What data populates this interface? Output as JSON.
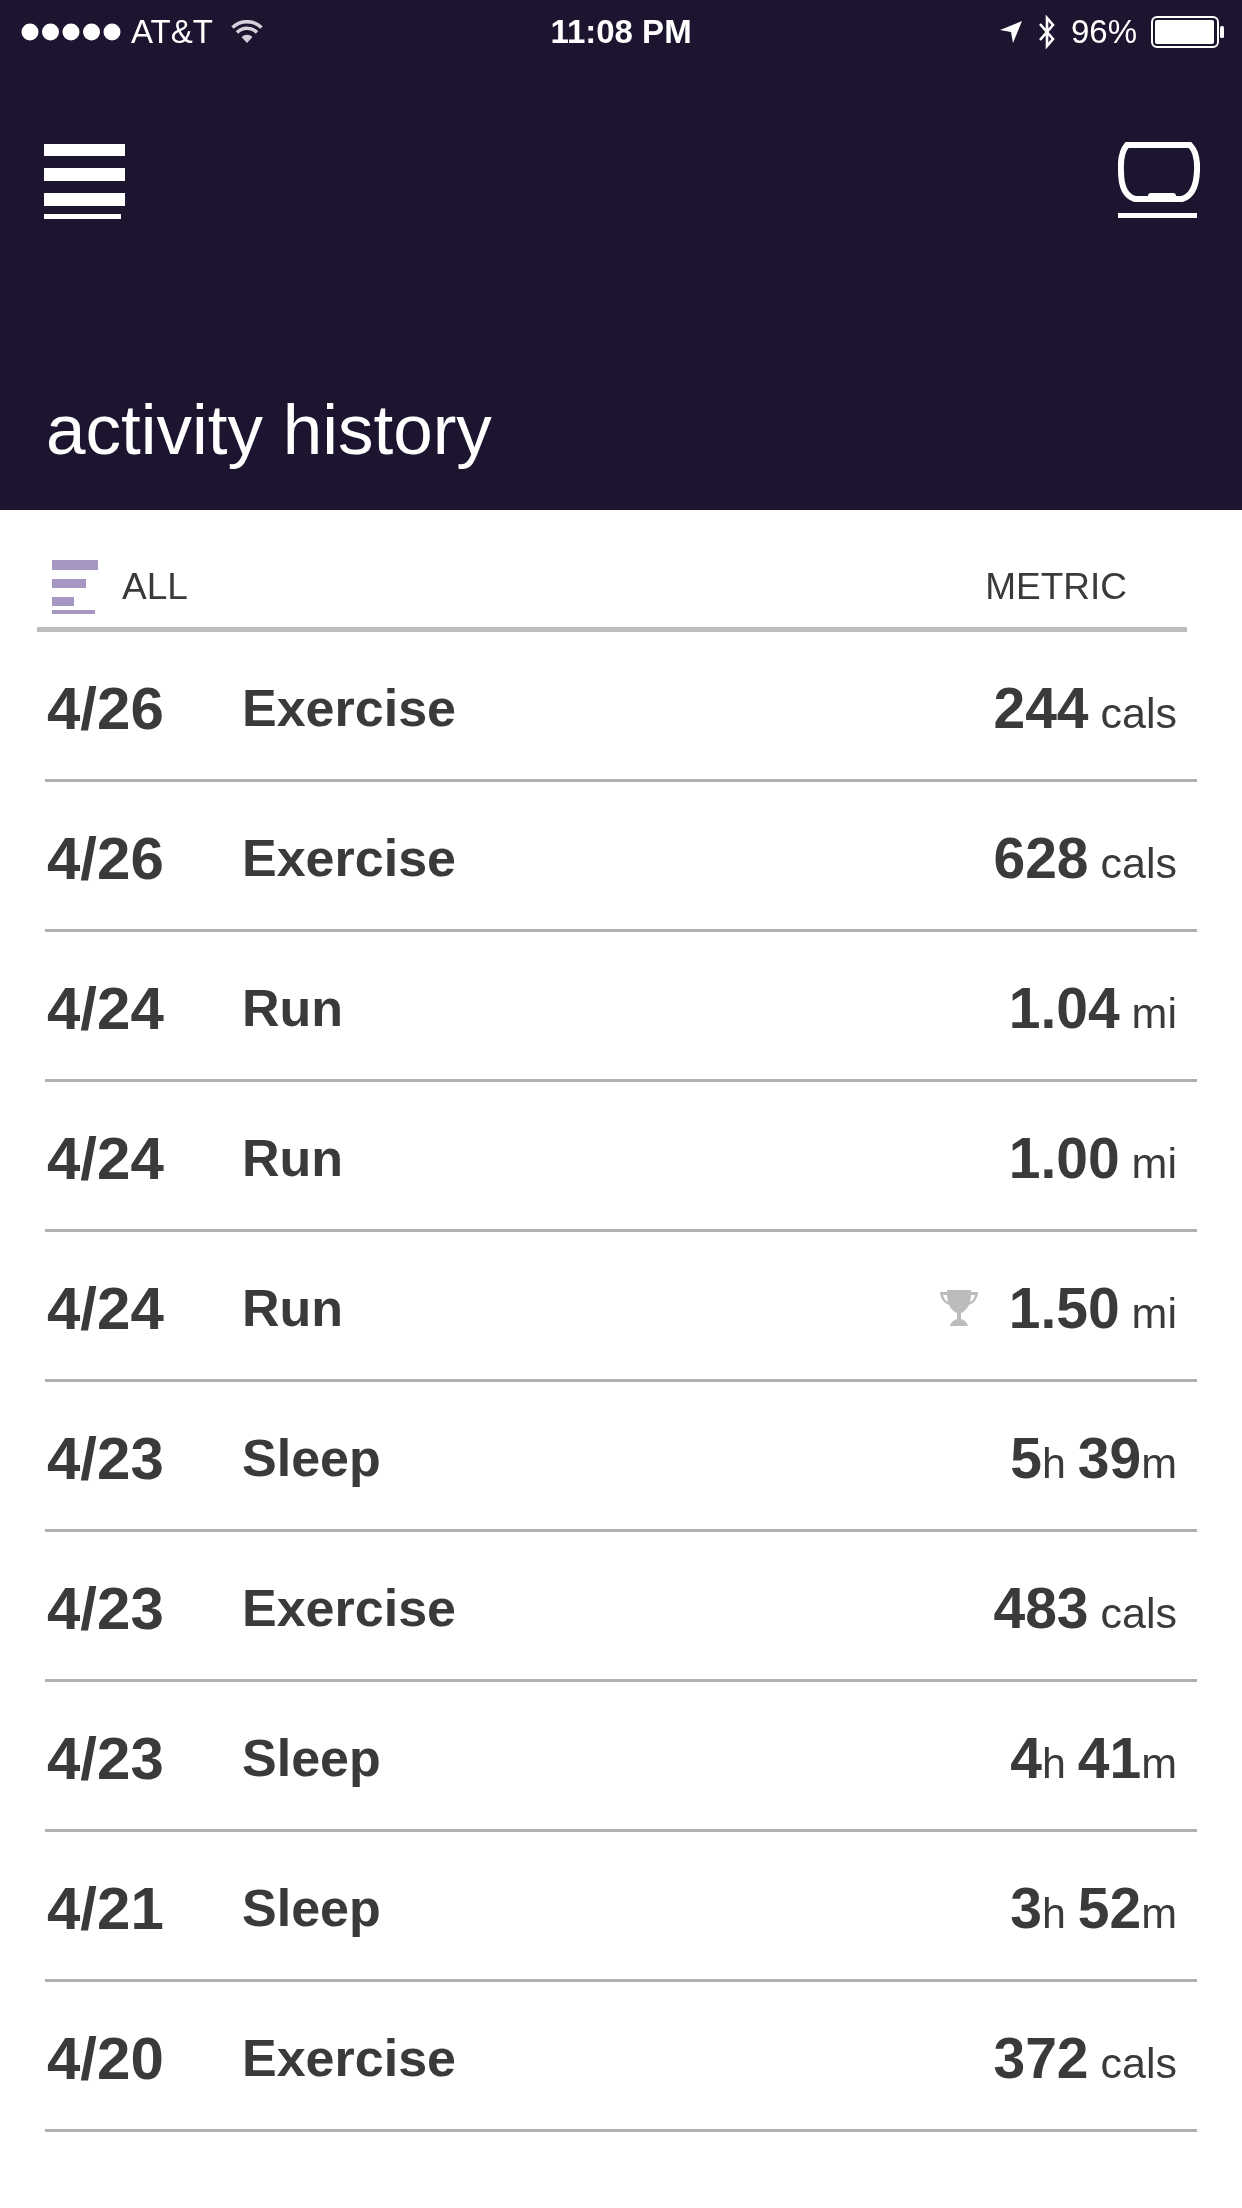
{
  "status_bar": {
    "carrier": "AT&T",
    "time": "11:08 PM",
    "battery": "96%"
  },
  "header": {
    "title": "activity history"
  },
  "filter": {
    "label": "ALL",
    "units": "METRIC"
  },
  "activities": [
    {
      "date": "4/26",
      "name": "Exercise",
      "metric": "**244** cals",
      "trophy": false
    },
    {
      "date": "4/26",
      "name": "Exercise",
      "metric": "**628** cals",
      "trophy": false
    },
    {
      "date": "4/24",
      "name": "Run",
      "metric": "**1.04** mi",
      "trophy": false
    },
    {
      "date": "4/24",
      "name": "Run",
      "metric": "**1.00** mi",
      "trophy": false
    },
    {
      "date": "4/24",
      "name": "Run",
      "metric": "**1.50** mi",
      "trophy": true
    },
    {
      "date": "4/23",
      "name": "Sleep",
      "metric": "**5**h **39**m",
      "trophy": false
    },
    {
      "date": "4/23",
      "name": "Exercise",
      "metric": "**483** cals",
      "trophy": false
    },
    {
      "date": "4/23",
      "name": "Sleep",
      "metric": "**4**h **41**m",
      "trophy": false
    },
    {
      "date": "4/21",
      "name": "Sleep",
      "metric": "**3**h **52**m",
      "trophy": false
    },
    {
      "date": "4/20",
      "name": "Exercise",
      "metric": "**372** cals",
      "trophy": false
    }
  ]
}
